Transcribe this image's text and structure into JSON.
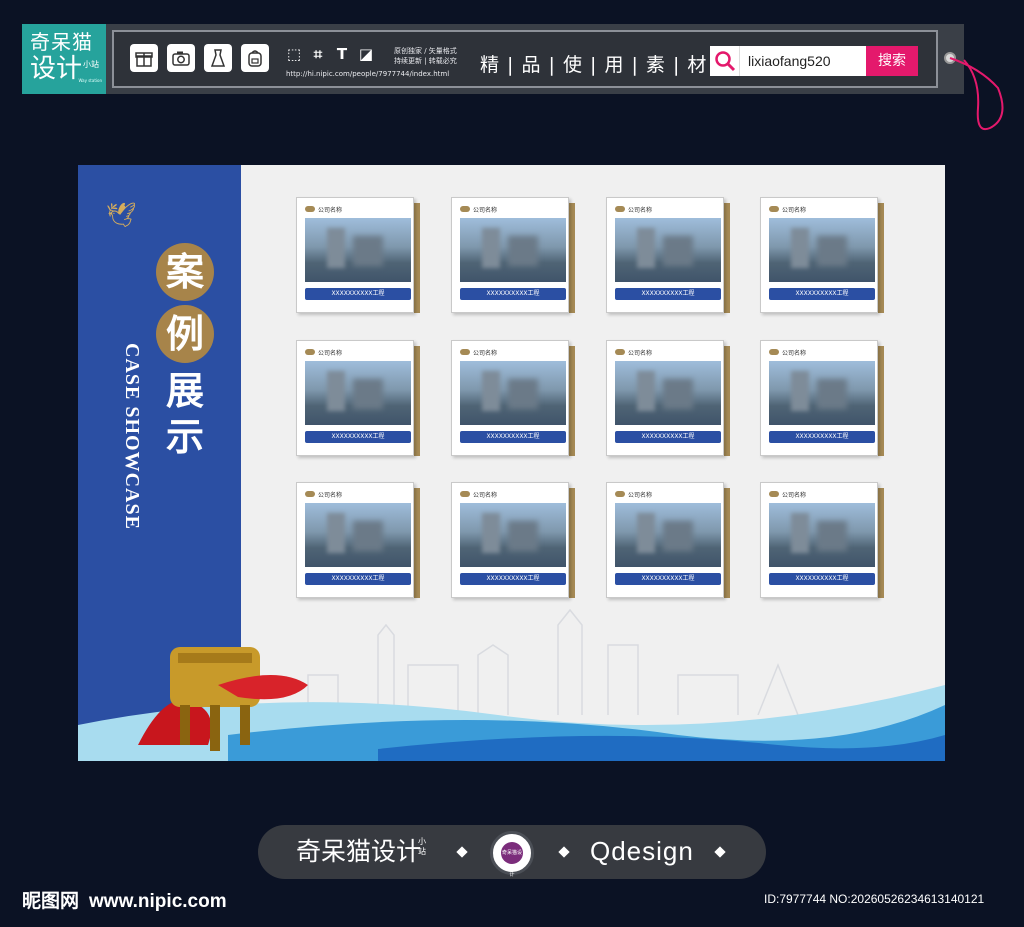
{
  "logo": {
    "line1": "奇呆猫",
    "line2": "设计",
    "small": "小站",
    "tiny": "Way station"
  },
  "toolbar": {
    "icons": [
      "gift-icon",
      "camera-icon",
      "dress-icon",
      "backpack-icon"
    ],
    "tools": [
      "select-icon",
      "crop-icon",
      "text-icon",
      "layer-icon"
    ],
    "notes_line1": "原创独家 / 矢量格式",
    "notes_line2": "持续更新 | 转载必究",
    "url": "http://hi.nipic.com/people/7977744/index.html",
    "features": "精 | 品 | 使 | 用 | 素 | 材",
    "search_value": "lixiaofang520",
    "search_button": "搜索"
  },
  "poster": {
    "title_chars": [
      "案",
      "例",
      "展",
      "示"
    ],
    "title_en": "CASE SHOWCASE",
    "card_company": "公司名称",
    "card_caption": "XXXXXXXXXX工程",
    "rows": 3,
    "cols": 4
  },
  "footer": {
    "brand_cn": "奇呆猫设计",
    "brand_small": "小站",
    "badge_text": "奇呆猫设计",
    "brand_en": "Qdesign",
    "wm_cn": "昵图网",
    "wm_site": "www.nipic.com",
    "wm_id": "ID:7977744 NO:20260526234613140121"
  },
  "colors": {
    "accent_pink": "#e4196c",
    "poster_blue": "#2b4fa3",
    "gold": "#a58a55",
    "teal": "#26a39c"
  }
}
